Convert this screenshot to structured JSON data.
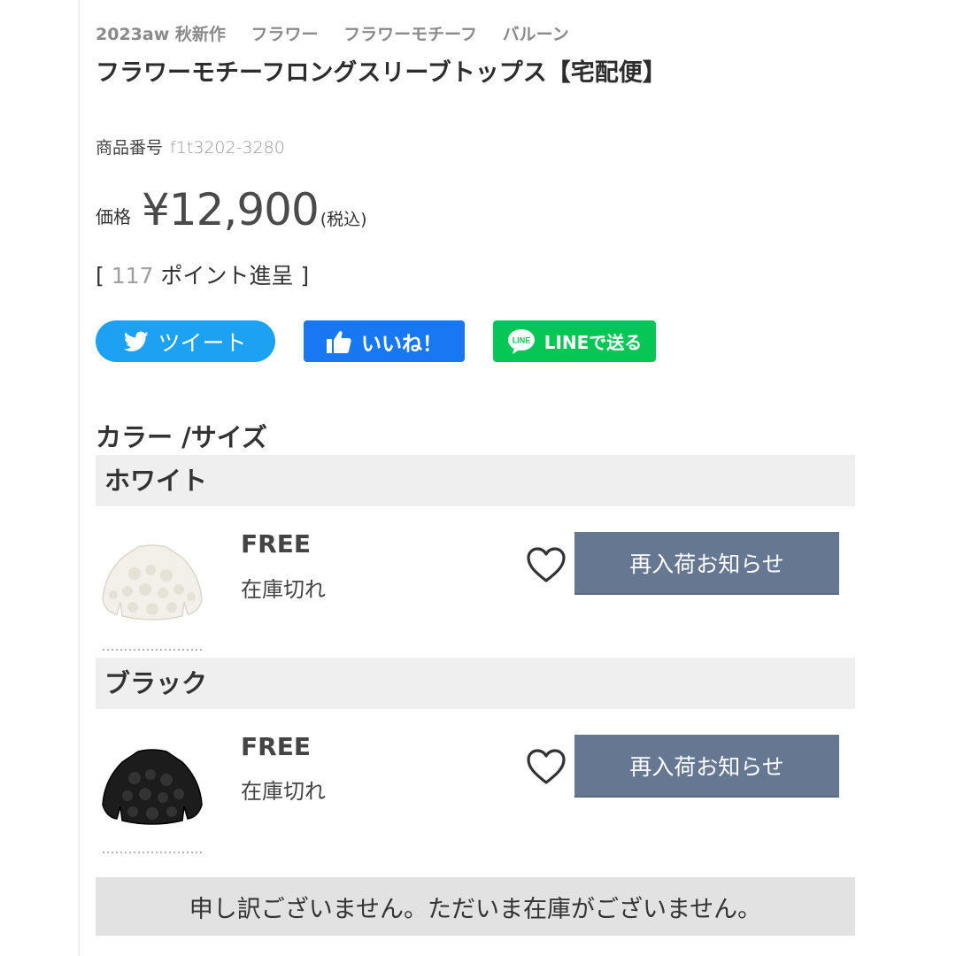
{
  "product": {
    "tags": [
      "2023aw 秋新作",
      "フラワー",
      "フラワーモチーフ",
      "バルーン"
    ],
    "title": "フラワーモチーフロングスリーブトップス【宅配便】",
    "sku_label": "商品番号",
    "sku_value": "f1t3202-3280",
    "price_label": "価格",
    "price_value": "¥12,900",
    "price_tax": "(税込)",
    "points_open": "[",
    "points_value": "117",
    "points_text": "ポイント進呈",
    "points_close": "]"
  },
  "share": {
    "twitter_label": "ツイート",
    "facebook_label": "いいね！",
    "line_label": "LINEで送る",
    "line_badge": "LINE",
    "colors": {
      "twitter": "#1da1f2",
      "facebook": "#1877f2",
      "line": "#06c755"
    }
  },
  "variants": {
    "section_title": "カラー /サイズ",
    "items": [
      {
        "color": "ホワイト",
        "size": "FREE",
        "stock": "在庫切れ",
        "restock_label": "再入荷お知らせ"
      },
      {
        "color": "ブラック",
        "size": "FREE",
        "stock": "在庫切れ",
        "restock_label": "再入荷お知らせ"
      }
    ],
    "restock_button_color": "#667792"
  },
  "notice": {
    "text": "申し訳ございません。ただいま在庫がございません。"
  }
}
